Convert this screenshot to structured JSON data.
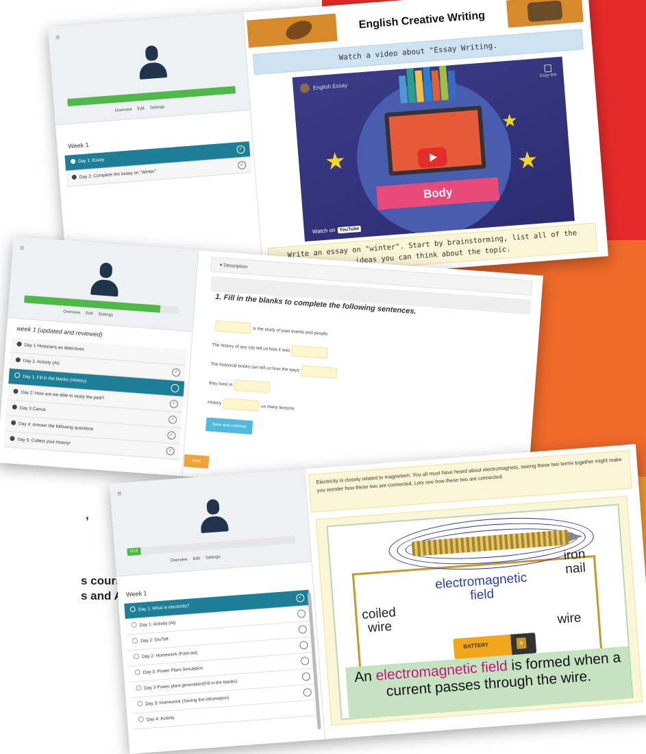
{
  "promo": {
    "line1": ",",
    "line2": "s courses",
    "line3": "s and AI"
  },
  "brand_colors": {
    "red": "#e52b2a",
    "orange": "#f06a2a",
    "amber": "#f39a2a",
    "teal": "#1d7f97"
  },
  "screen1": {
    "progress_pct": 100,
    "buttons": [
      "Overview",
      "Edit",
      "Settings"
    ],
    "week_title": "Week 1",
    "items": [
      {
        "label": "Day 1: Essay",
        "active": true,
        "status_icon": "check-circle-icon"
      },
      {
        "label": "Day 2: Complete the essay on \"Winter\"",
        "active": false,
        "status_icon": "check-circle-icon"
      }
    ],
    "course_title": "English Creative Writing",
    "watch_text": "Watch a video about \"Essay Writing.",
    "video": {
      "channel": "English Essay",
      "copy_link": "Copy link",
      "section_word": "Body",
      "watch_on": "Watch on",
      "yt_brand": "YouTube"
    },
    "task_text_line1": "Write an essay on \"winter\". Start by brainstorming, list all of the",
    "task_text_line2": "ideas you can think about the topic."
  },
  "screen2": {
    "progress_pct": 88,
    "buttons": [
      "Overview",
      "Edit",
      "Settings"
    ],
    "week_title": "week 1 (updated and reviewed)",
    "items": [
      {
        "label": "Day 1 Historians as detectives",
        "active": false
      },
      {
        "label": "Day 1: Activity (AI)",
        "active": false
      },
      {
        "label": "Day 1: Fill in the blanks (History)",
        "active": true
      },
      {
        "label": "Day 2: How are we able to study the past?",
        "active": false
      },
      {
        "label": "Day 3 Canva",
        "active": false
      },
      {
        "label": "Day 4: Answer the following questions",
        "active": false
      },
      {
        "label": "Day 5: Collect your history!",
        "active": false
      }
    ],
    "description_label": "Description",
    "question_title": "1. Fill in the blanks to complete the following sentences.",
    "fill_lines": [
      {
        "before": "",
        "after": "is the study of past events and people."
      },
      {
        "before": "The history of any city tell us how it was",
        "after": ""
      },
      {
        "before": "The historical books can tell us how the ways",
        "after": ""
      },
      {
        "before": "they lived in",
        "after": ""
      },
      {
        "before": "History",
        "after": "us many lessons."
      }
    ],
    "save_button": "Save and continue",
    "side_tab": "Next"
  },
  "screen3": {
    "progress_pct": 8,
    "progress_text": "1/14",
    "buttons": [
      "Overview",
      "Edit",
      "Settings"
    ],
    "week_title": "Week 1",
    "items": [
      {
        "label": "Day 1: What is electricity?",
        "active": true
      },
      {
        "label": "Day 1: Activity (AI)",
        "active": false
      },
      {
        "label": "Day 2: Do/Tell",
        "active": false
      },
      {
        "label": "Day 2: Homework (Fold-out)",
        "active": false
      },
      {
        "label": "Day 3: Power Plant Simulation",
        "active": false
      },
      {
        "label": "Day 3 Power plant generation(Fill in the blanks)",
        "active": false
      },
      {
        "label": "Day 3: Homework (Saving the information)",
        "active": false
      },
      {
        "label": "Day 4: Activity",
        "active": false
      }
    ],
    "intro_text": "Electricity is closely related to magnetism. You all must have heard about electromagnets, seeing these two terms together might make you wonder how these two are connected. Lets see how these two are connected.",
    "illustration": {
      "label_field": "electromagnetic field",
      "label_field_l1": "electromagnetic",
      "label_field_l2": "field",
      "label_iron_l1": "iron",
      "label_iron_l2": "nail",
      "label_coil_l1": "coiled",
      "label_coil_l2": "wire",
      "label_wire": "wire",
      "battery": "BATTERY",
      "caption_pre": "An",
      "caption_highlight": "electromagnetic field",
      "caption_mid": "is",
      "caption_rest": "formed when a current passes through the wire."
    }
  }
}
